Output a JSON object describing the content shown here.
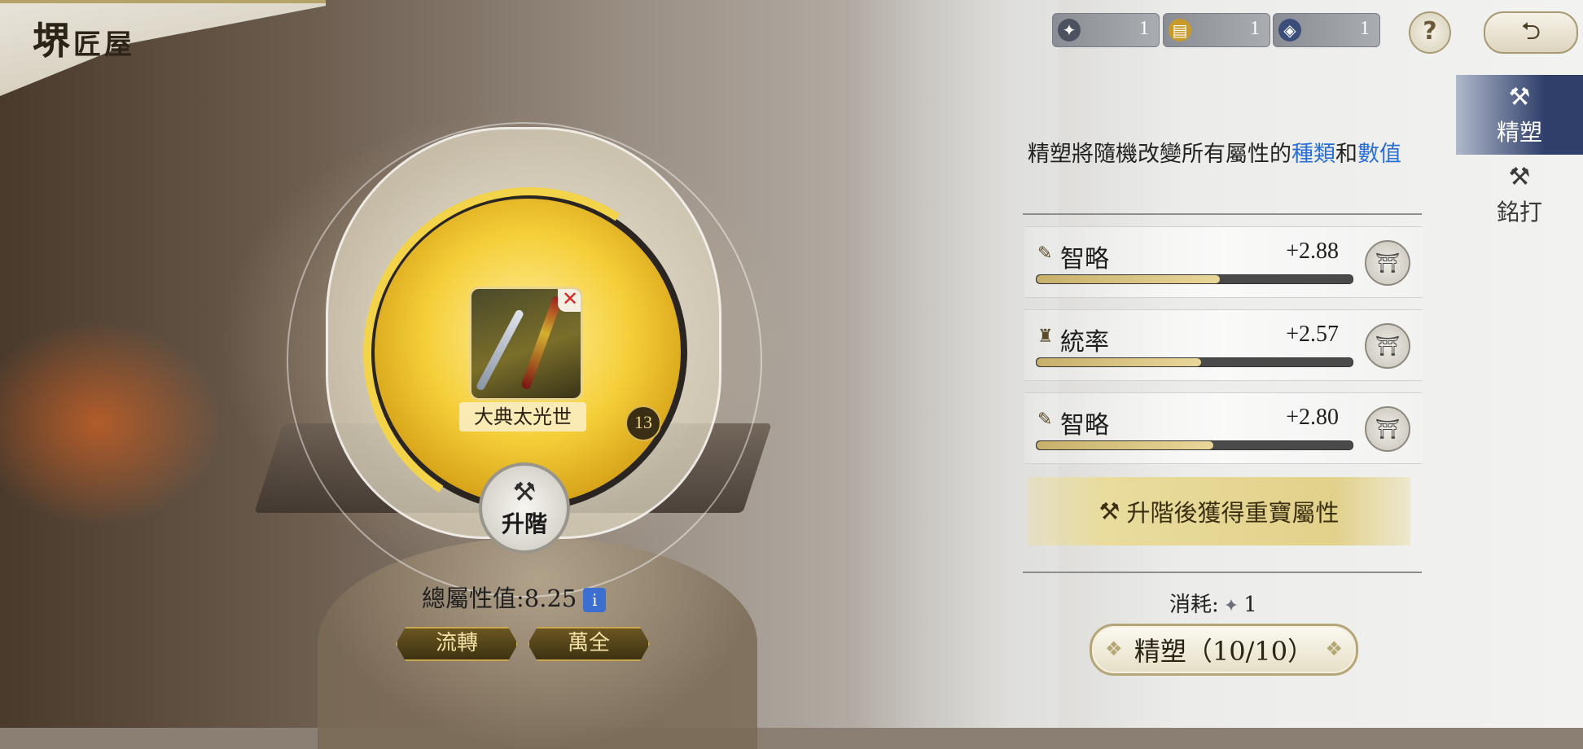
{
  "header": {
    "title_a": "堺",
    "title_b": "匠屋"
  },
  "currencies": [
    {
      "icon": "ore-icon",
      "value": "1",
      "color": "#4c5260"
    },
    {
      "icon": "gold-scroll-icon",
      "value": "1",
      "color": "#c79a2a"
    },
    {
      "icon": "blue-gem-icon",
      "value": "1",
      "color": "#3b4e7a"
    }
  ],
  "top_buttons": {
    "help": "?",
    "back": "⮌"
  },
  "side_tabs": [
    {
      "label": "精塑",
      "icon": "hammer-up-icon",
      "active": true
    },
    {
      "label": "銘打",
      "icon": "hammer-tools-icon",
      "active": false
    }
  ],
  "description": {
    "part1": "精塑將隨機改變所有屬性的",
    "hl1": "種類",
    "part2": "和",
    "hl2": "數值"
  },
  "attributes": [
    {
      "icon": "strategy-icon",
      "name": "智略",
      "value": "+2.88",
      "fill": 0.58
    },
    {
      "icon": "command-icon",
      "name": "統率",
      "value": "+2.57",
      "fill": 0.52
    },
    {
      "icon": "strategy-icon",
      "name": "智略",
      "value": "+2.80",
      "fill": 0.56
    }
  ],
  "upgrade_banner": "升階後獲得重寶屬性",
  "cost": {
    "label": "消耗:",
    "value": "1"
  },
  "refine_button": "精塑（10/10）",
  "equipment": {
    "name": "大典太光世",
    "level": "13",
    "ascend_label": "升階",
    "total_label": "總屬性值:8.25",
    "info": "i",
    "progress": 0.8
  },
  "chips": [
    "流轉",
    "萬全"
  ]
}
